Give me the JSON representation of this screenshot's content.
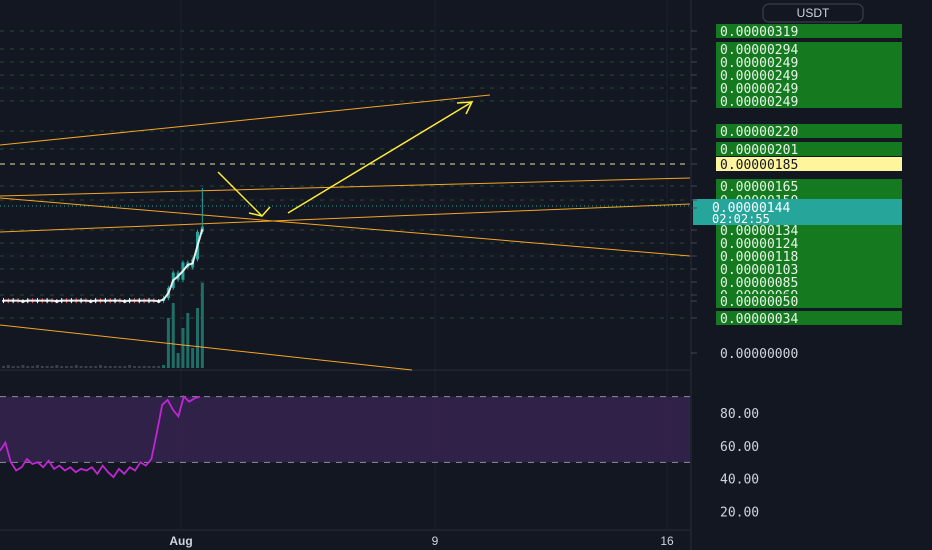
{
  "header": {
    "currency": "USDT"
  },
  "colors": {
    "background": "#131722",
    "price_tag_bg": "#157a1f",
    "price_tag_text": "#e8f5e9",
    "highlight_tag_bg": "#fff59d",
    "current_price_bg": "#26a69a",
    "candle_up": "#26a69a",
    "candle_down": "#ef5350",
    "trend_line": "#f5a623",
    "arrow": "#ffeb3b",
    "rsi_line": "#c026d3",
    "rsi_band": "#3b2557",
    "axis_text": "#d1d4dc"
  },
  "chart_data": [
    {
      "type": "candlestick",
      "title": "",
      "currency": "USDT",
      "y_axis_labels": [
        "0.00000319",
        "0.00000294",
        "0.00000249",
        "0.00000249",
        "0.00000249",
        "0.00000249",
        "0.00000220",
        "0.00000201",
        "0.00000185",
        "0.00000165",
        "0.00000150",
        "0.00000144",
        "0.00000134",
        "0.00000124",
        "0.00000118",
        "0.00000103",
        "0.00000085",
        "0.00000069",
        "0.00000050",
        "0.00000034",
        "0.00000000"
      ],
      "highlight_level": "0.00000185",
      "current_price": {
        "value": "0.00000144",
        "countdown": "02:02:55"
      },
      "x_axis_labels": [
        "Aug",
        "9",
        "16"
      ],
      "candles_open_close": [
        [
          0.77,
          0.78
        ],
        [
          0.78,
          0.77
        ],
        [
          0.77,
          0.78
        ],
        [
          0.78,
          0.77
        ],
        [
          0.77,
          0.77
        ],
        [
          0.77,
          0.78
        ],
        [
          0.78,
          0.77
        ],
        [
          0.77,
          0.78
        ],
        [
          0.78,
          0.77
        ],
        [
          0.77,
          0.78
        ],
        [
          0.78,
          0.77
        ],
        [
          0.77,
          0.77
        ],
        [
          0.77,
          0.78
        ],
        [
          0.78,
          0.77
        ],
        [
          0.77,
          0.78
        ],
        [
          0.78,
          0.77
        ],
        [
          0.77,
          0.78
        ],
        [
          0.78,
          0.77
        ],
        [
          0.77,
          0.77
        ],
        [
          0.77,
          0.78
        ],
        [
          0.78,
          0.77
        ],
        [
          0.77,
          0.78
        ],
        [
          0.78,
          0.77
        ],
        [
          0.77,
          0.78
        ],
        [
          0.78,
          0.77
        ],
        [
          0.77,
          0.77
        ],
        [
          0.77,
          0.78
        ],
        [
          0.78,
          0.77
        ],
        [
          0.77,
          0.78
        ],
        [
          0.78,
          0.77
        ],
        [
          0.77,
          0.78
        ],
        [
          0.78,
          0.77
        ],
        [
          0.77,
          0.77
        ],
        [
          0.77,
          0.8
        ],
        [
          0.8,
          0.9
        ],
        [
          0.9,
          1.05
        ],
        [
          1.05,
          0.98
        ],
        [
          0.98,
          1.15
        ],
        [
          1.15,
          1.1
        ],
        [
          1.1,
          1.18
        ],
        [
          1.18,
          1.45
        ],
        [
          1.45,
          1.5
        ]
      ],
      "last_candle_high": 1.88
    },
    {
      "type": "line",
      "title": "",
      "y_axis_labels": [
        "80.00",
        "60.00",
        "40.00",
        "20.00"
      ],
      "ylim": [
        10,
        105
      ],
      "band": [
        50,
        90
      ],
      "values": [
        57,
        62,
        50,
        45,
        47,
        52,
        49,
        50,
        47,
        51,
        46,
        48,
        45,
        47,
        44,
        46,
        45,
        47,
        43,
        48,
        44,
        41,
        46,
        43,
        47,
        45,
        50,
        48,
        52,
        68,
        85,
        88,
        82,
        78,
        90,
        87,
        89,
        90
      ]
    }
  ]
}
